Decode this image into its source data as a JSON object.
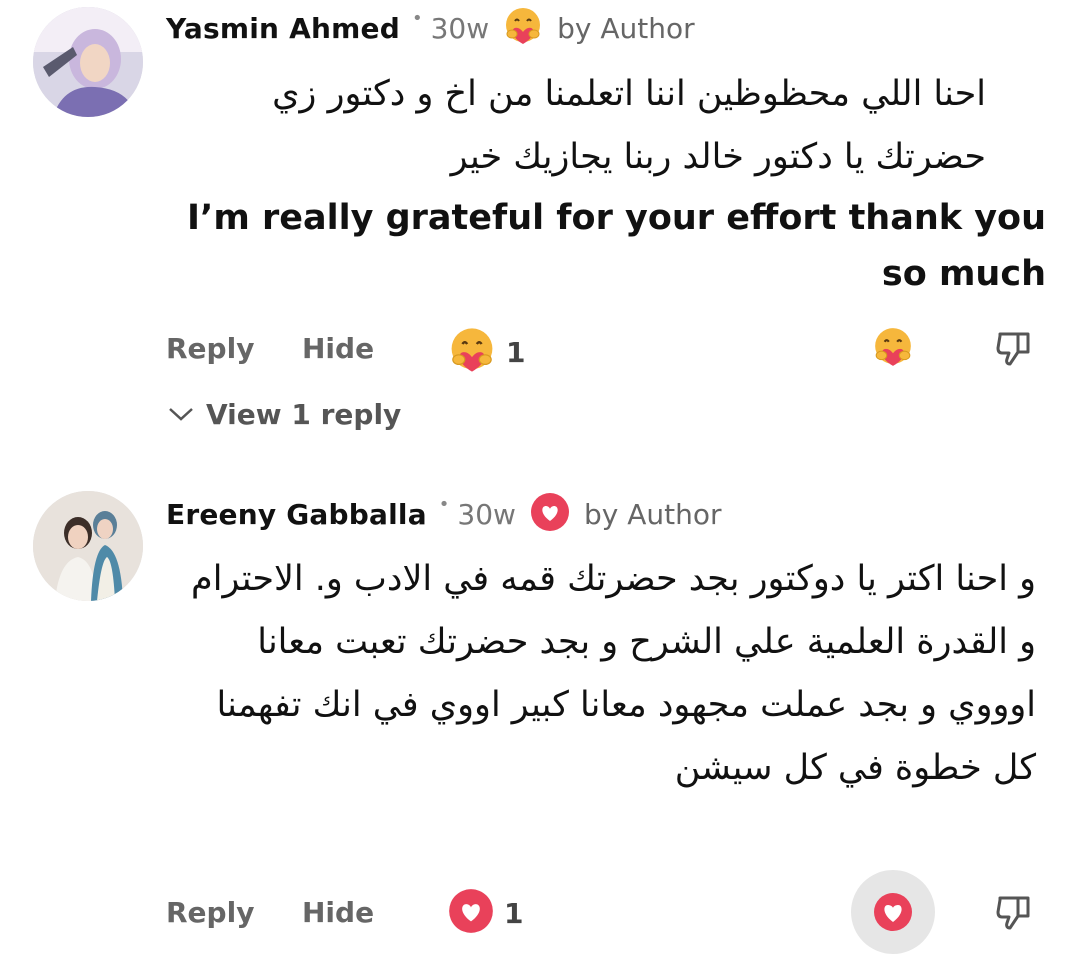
{
  "comments": [
    {
      "author": "Yasmin Ahmed",
      "time": "30w",
      "by_author_label": "by  Author",
      "author_reaction_icon": "hug-emoji",
      "text_arabic": "احنا اللي محظوظين اننا اتعلمنا من اخ و دكتور زي حضرتك يا دكتور خالد ربنا يجازيك خير",
      "text_english": "I’m really grateful for your effort thank you so much",
      "actions": {
        "reply": "Reply",
        "hide": "Hide"
      },
      "reaction_icon": "hug-emoji",
      "reaction_count": "1",
      "view_replies": "View  1  reply"
    },
    {
      "author": "Ereeny Gabballa",
      "time": "30w",
      "by_author_label": "by  Author",
      "author_reaction_icon": "heart-icon",
      "text_arabic": "و احنا اكتر يا دوكتور بجد حضرتك قمه في الادب و. الاحترام و القدرة العلمية علي الشرح و بجد حضرتك تعبت معانا اوووي و بجد عملت مجهود معانا كبير اووي في انك تفهمنا كل خطوة في كل سيشن",
      "actions": {
        "reply": "Reply",
        "hide": "Hide"
      },
      "reaction_icon": "heart-icon",
      "reaction_count": "1"
    }
  ],
  "colors": {
    "heart": "#e9415a",
    "hug_face": "#f6b73c",
    "hug_heart": "#e9415a",
    "muted_text": "#666666",
    "active_bg": "#e6e6e6"
  }
}
